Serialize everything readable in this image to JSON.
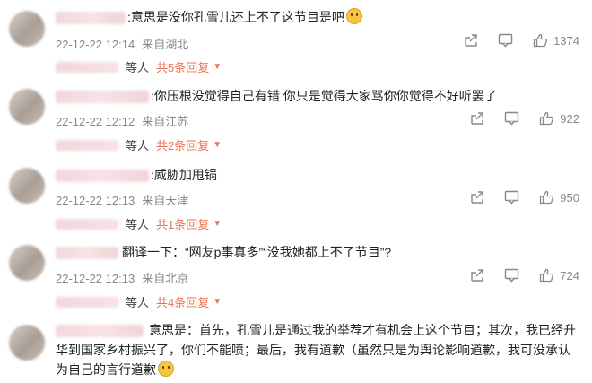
{
  "comments": [
    {
      "text": ":意思是没你孔雪儿还上不了这节目是吧",
      "date": "22-12-22 12:14",
      "location": "来自湖北",
      "likes": "1374",
      "reply_people": "等人",
      "reply_count": "共5条回复"
    },
    {
      "text": ":你压根没觉得自己有错 你只是觉得大家骂你你觉得不好听罢了",
      "date": "22-12-22 12:12",
      "location": "来自江苏",
      "likes": "922",
      "reply_people": "等人",
      "reply_count": "共2条回复"
    },
    {
      "text": ":威胁加甩锅",
      "date": "22-12-22 12:13",
      "location": "来自天津",
      "likes": "950",
      "reply_people": "等人",
      "reply_count": "共1条回复"
    },
    {
      "text": "翻译一下：“网友p事真多”“没我她都上不了节目”?",
      "date": "22-12-22 12:13",
      "location": "来自北京",
      "likes": "724",
      "reply_people": "等人",
      "reply_count": "共4条回复"
    },
    {
      "text": "意思是：首先，孔雪儿是通过我的举荐才有机会上这个节目；其次，我已经升华到国家乡村振兴了，你们不能喷；最后，我有道歉（虽然只是为舆论影响道歉，我可没承认为自己的言行道歉"
    }
  ],
  "icons": [
    "share-icon",
    "comment-icon",
    "like-icon",
    "emoji-icon"
  ],
  "colors": {
    "accent": "#eb7350",
    "meta": "#888888"
  }
}
